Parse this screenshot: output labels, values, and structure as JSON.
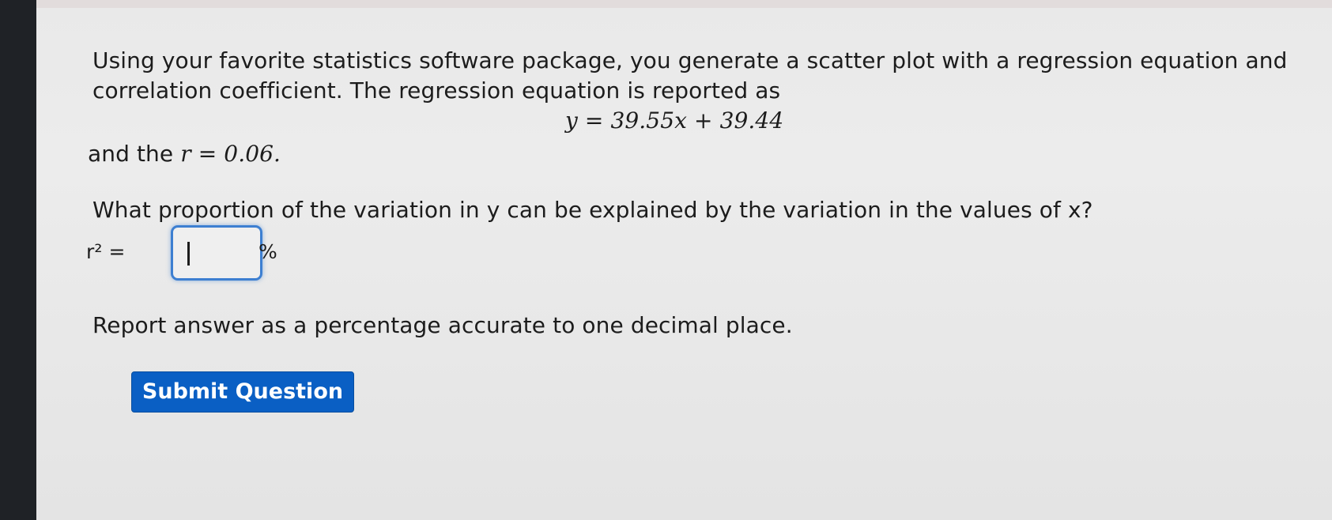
{
  "question": {
    "intro_line1": "Using your favorite statistics software package, you generate a scatter plot with a regression equation and",
    "intro_line2": "correlation coefficient. The regression equation is reported as",
    "equation": "y = 39.55x + 39.44",
    "r_prefix": "and the ",
    "r_expr": "r = 0.06.",
    "prompt": "What proportion of the variation in y can be explained by the variation in the values of x?",
    "answer_label": "r² =",
    "answer_value": "",
    "answer_unit": "%",
    "instruction": "Report answer as a percentage accurate to one decimal place."
  },
  "actions": {
    "submit_label": "Submit Question"
  },
  "colors": {
    "submit_button": "#0a5fc4",
    "input_focus_border": "#3d7fd1"
  }
}
